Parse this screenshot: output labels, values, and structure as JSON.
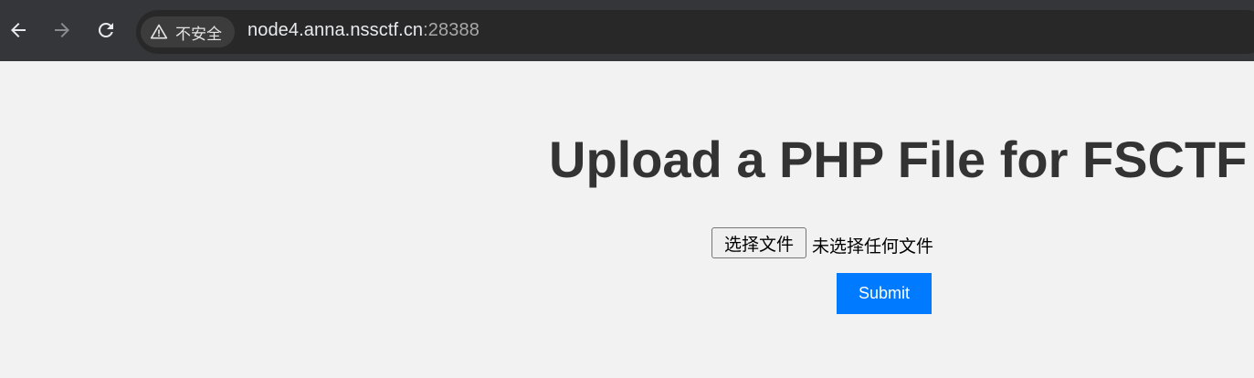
{
  "browser": {
    "security_label": "不安全",
    "url_host": "node4.anna.nssctf.cn",
    "url_port": ":28388",
    "icons": {
      "back": "back-arrow-icon",
      "forward": "forward-arrow-icon",
      "reload": "reload-icon",
      "warning": "warning-triangle-icon"
    }
  },
  "page": {
    "title": "Upload a PHP File for FSCTF",
    "file_button_label": "选择文件",
    "file_status": "未选择任何文件",
    "submit_label": "Submit"
  },
  "colors": {
    "toolbar_bg": "#35363a",
    "page_bg": "#f2f2f2",
    "title_color": "#333333",
    "submit_bg": "#007bff"
  }
}
